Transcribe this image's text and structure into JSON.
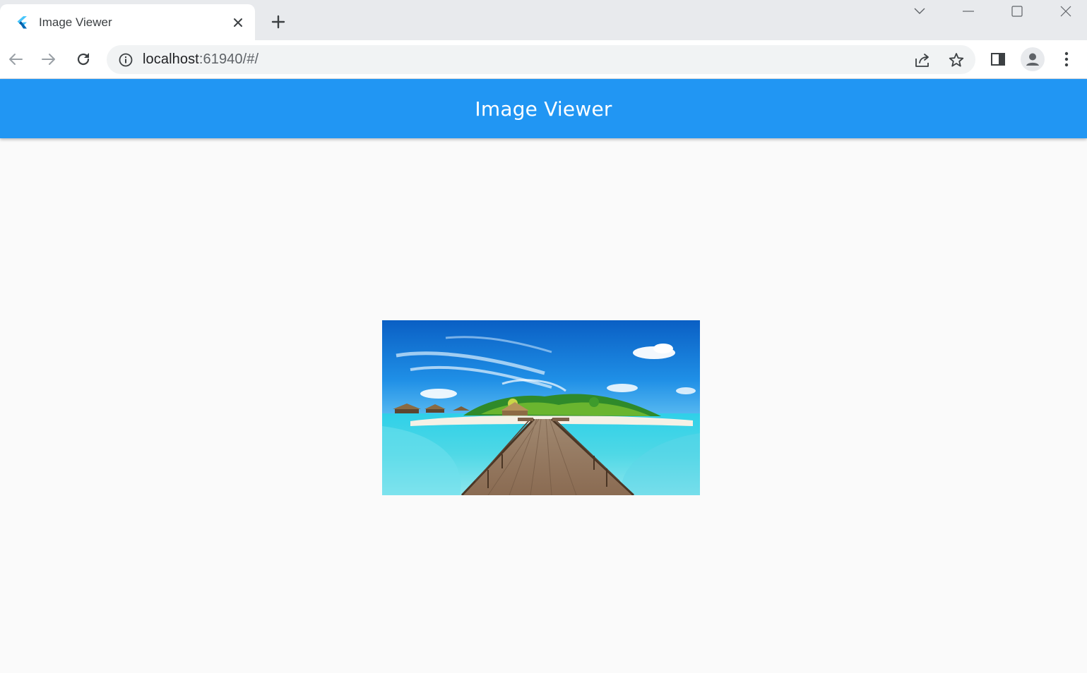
{
  "browser": {
    "tab": {
      "title": "Image Viewer",
      "favicon": "flutter-icon"
    },
    "window_controls": [
      "tab-search-icon",
      "minimize-icon",
      "maximize-icon",
      "close-icon"
    ],
    "toolbar": {
      "url_host": "localhost",
      "url_rest": ":61940/#/",
      "icons": [
        "back-icon",
        "forward-icon",
        "reload-icon",
        "site-info-icon",
        "share-icon",
        "bookmark-star-icon",
        "side-panel-icon",
        "profile-icon",
        "more-menu-icon"
      ]
    }
  },
  "app": {
    "title": "Image Viewer",
    "appbar_color": "#2196f3",
    "image": {
      "subject": "tropical island with wooden pier over turquoise water"
    }
  }
}
